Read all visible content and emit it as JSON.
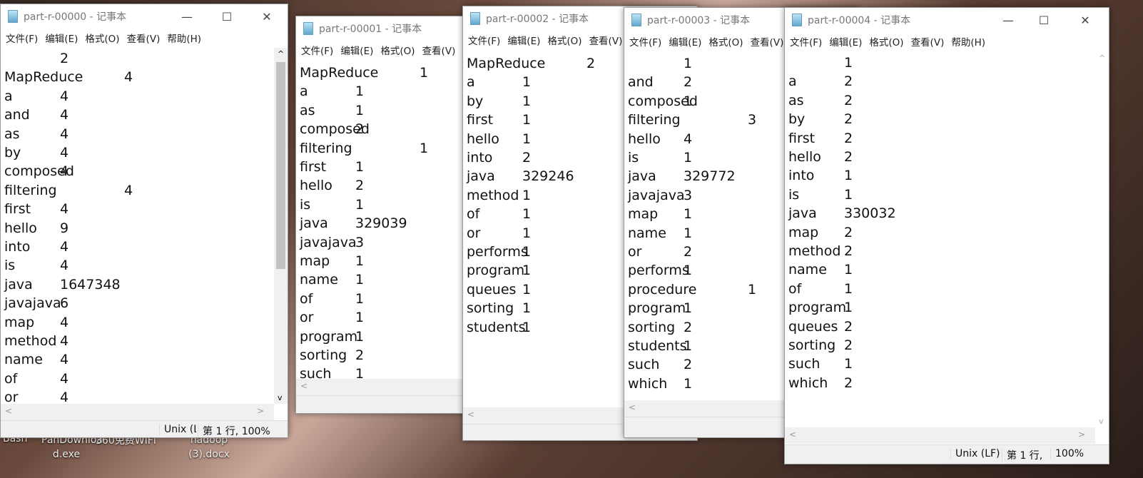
{
  "menu": [
    "文件(F)",
    "编辑(E)",
    "格式(O)",
    "查看(V)",
    "帮助(H)"
  ],
  "icons": {
    "minimize": "—",
    "maximize": "☐",
    "close": "✕",
    "scroll_up": "^",
    "scroll_down": "v",
    "scroll_left": "<",
    "scroll_right": ">"
  },
  "desktop": [
    "Bash",
    "PanDownloa d.exe",
    "360免费WIFI",
    "hadoop (3).docx"
  ],
  "windows": [
    {
      "title": "part-r-00000 - 记事本",
      "status": {
        "eol": "Unix (L",
        "pos": "第 1 行, 100%"
      },
      "lines": [
        [
          "",
          "2"
        ],
        [
          "MapReduce",
          "4"
        ],
        [
          "a",
          "4"
        ],
        [
          "and",
          "4"
        ],
        [
          "as",
          "4"
        ],
        [
          "by",
          "4"
        ],
        [
          "composed",
          "4"
        ],
        [
          "filtering",
          "4"
        ],
        [
          "first",
          "4"
        ],
        [
          "hello",
          "9"
        ],
        [
          "into",
          "4"
        ],
        [
          "is",
          "4"
        ],
        [
          "java",
          "1647348"
        ],
        [
          "javajava",
          "6"
        ],
        [
          "map",
          "4"
        ],
        [
          "method",
          "4"
        ],
        [
          "name",
          "4"
        ],
        [
          "of",
          "4"
        ],
        [
          "or",
          "4"
        ]
      ]
    },
    {
      "title": "part-r-00001 - 记事本",
      "lines": [
        [
          "MapReduce",
          "1"
        ],
        [
          "a",
          "1"
        ],
        [
          "as",
          "1"
        ],
        [
          "composed",
          "2"
        ],
        [
          "filtering",
          "1"
        ],
        [
          "first",
          "1"
        ],
        [
          "hello",
          "2"
        ],
        [
          "is",
          "1"
        ],
        [
          "java",
          "329039"
        ],
        [
          "javajava",
          "3"
        ],
        [
          "map",
          "1"
        ],
        [
          "name",
          "1"
        ],
        [
          "of",
          "1"
        ],
        [
          "or",
          "1"
        ],
        [
          "program",
          "1"
        ],
        [
          "sorting",
          "2"
        ],
        [
          "such",
          "1"
        ]
      ]
    },
    {
      "title": "part-r-00002 - 记事本",
      "lines": [
        [
          "MapReduce",
          "2"
        ],
        [
          "a",
          "1"
        ],
        [
          "by",
          "1"
        ],
        [
          "first",
          "1"
        ],
        [
          "hello",
          "1"
        ],
        [
          "into",
          "2"
        ],
        [
          "java",
          "329246"
        ],
        [
          "method",
          "1"
        ],
        [
          "of",
          "1"
        ],
        [
          "or",
          "1"
        ],
        [
          "performs",
          "1"
        ],
        [
          "program",
          "1"
        ],
        [
          "queues",
          "1"
        ],
        [
          "sorting",
          "1"
        ],
        [
          "students",
          "1"
        ]
      ]
    },
    {
      "title": "part-r-00003 - 记事本",
      "lines": [
        [
          "",
          "1"
        ],
        [
          "and",
          "2"
        ],
        [
          "composed",
          "1"
        ],
        [
          "filtering",
          "3"
        ],
        [
          "hello",
          "4"
        ],
        [
          "is",
          "1"
        ],
        [
          "java",
          "329772"
        ],
        [
          "javajava",
          "3"
        ],
        [
          "map",
          "1"
        ],
        [
          "name",
          "1"
        ],
        [
          "or",
          "2"
        ],
        [
          "performs",
          "1"
        ],
        [
          "procedure",
          "1"
        ],
        [
          "program",
          "1"
        ],
        [
          "sorting",
          "2"
        ],
        [
          "students",
          "1"
        ],
        [
          "such",
          "2"
        ],
        [
          "which",
          "1"
        ]
      ]
    },
    {
      "title": "part-r-00004 - 记事本",
      "status": {
        "eol": "Unix (LF)",
        "line": "第 1 行,",
        "zoom": "100%"
      },
      "lines": [
        [
          "",
          "1"
        ],
        [
          "a",
          "2"
        ],
        [
          "as",
          "2"
        ],
        [
          "by",
          "2"
        ],
        [
          "first",
          "2"
        ],
        [
          "hello",
          "2"
        ],
        [
          "into",
          "1"
        ],
        [
          "is",
          "1"
        ],
        [
          "java",
          "330032"
        ],
        [
          "map",
          "2"
        ],
        [
          "method",
          "2"
        ],
        [
          "name",
          "1"
        ],
        [
          "of",
          "1"
        ],
        [
          "program",
          "1"
        ],
        [
          "queues",
          "2"
        ],
        [
          "sorting",
          "2"
        ],
        [
          "such",
          "1"
        ],
        [
          "which",
          "2"
        ]
      ]
    }
  ]
}
